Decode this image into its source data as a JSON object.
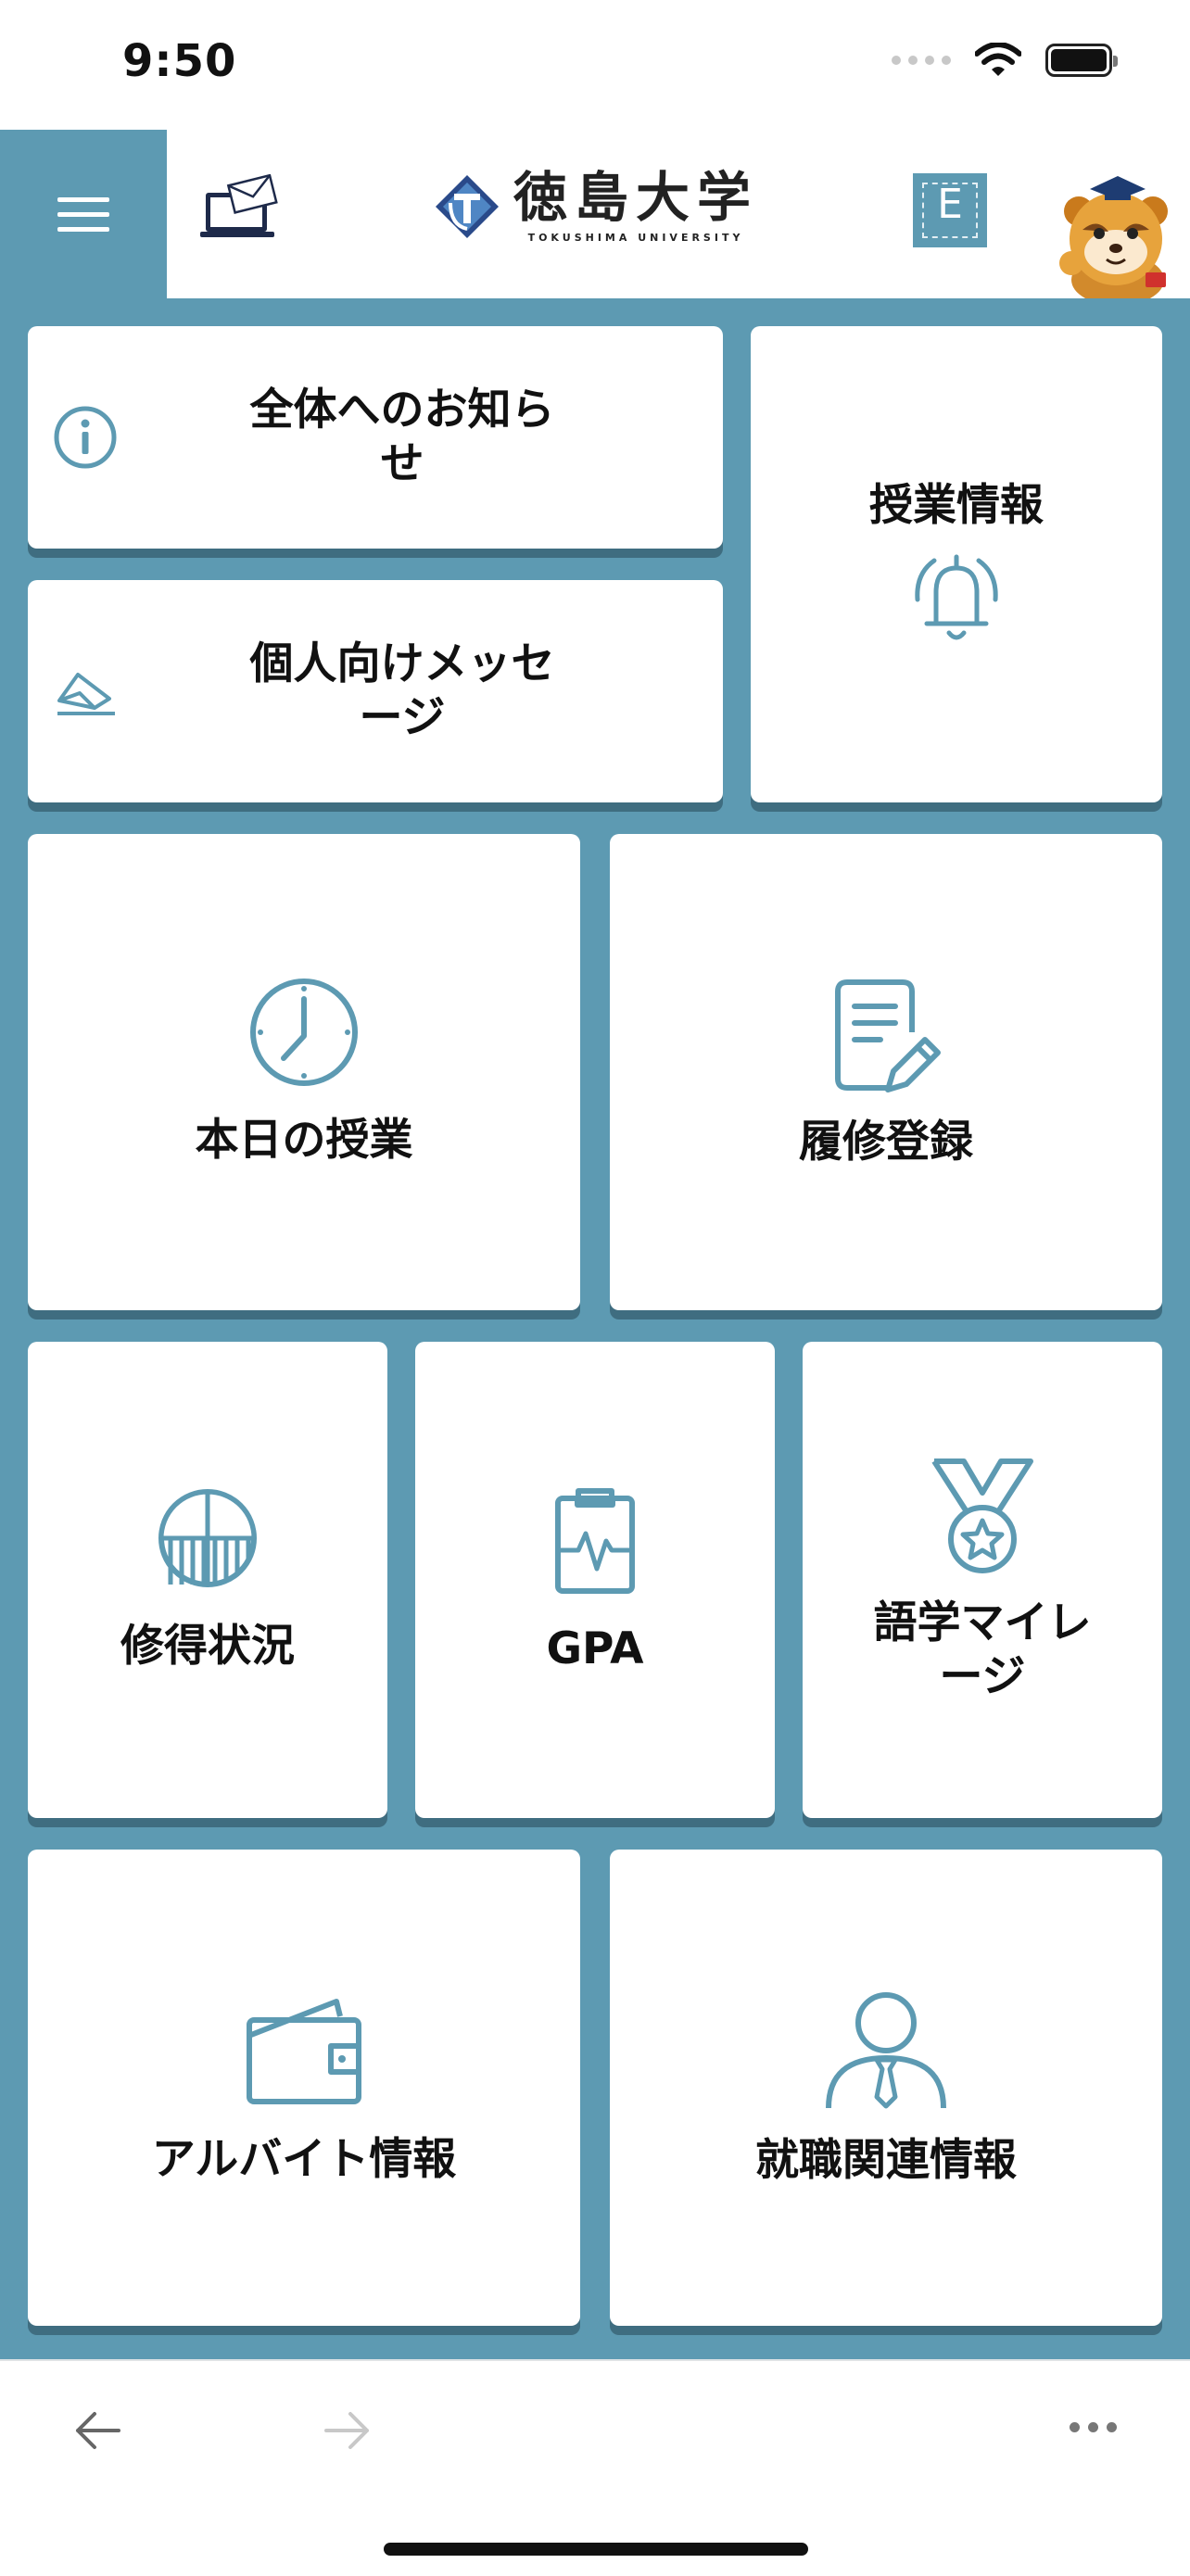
{
  "status_bar": {
    "time": "9:50"
  },
  "header": {
    "logo_jp": "徳島大学",
    "logo_en": "TOKUSHIMA UNIVERSITY",
    "e_button_label": "E"
  },
  "tiles": {
    "notice_all": "全体へのお知らせ",
    "personal_messages": "個人向けメッセージ",
    "class_info": "授業情報",
    "today_classes": "本日の授業",
    "course_registration": "履修登録",
    "credits_status": "修得状況",
    "gpa": "GPA",
    "language_mileage": "語学マイレージ",
    "part_time_jobs": "アルバイト情報",
    "career_info": "就職関連情報"
  },
  "colors": {
    "accent": "#5d9ab2",
    "tile_shadow": "#3f6d80",
    "icon_color": "#5d9ab2"
  },
  "icons": {
    "menu": "hamburger-icon",
    "mail": "laptop-mail-icon",
    "e": "e-box-icon",
    "info": "info-icon",
    "message": "envelope-icon",
    "bell": "bell-icon",
    "clock": "clock-icon",
    "document": "document-edit-icon",
    "pie": "pie-chart-icon",
    "clipboard": "clipboard-pulse-icon",
    "medal": "medal-icon",
    "wallet": "wallet-icon",
    "person": "person-tie-icon"
  }
}
